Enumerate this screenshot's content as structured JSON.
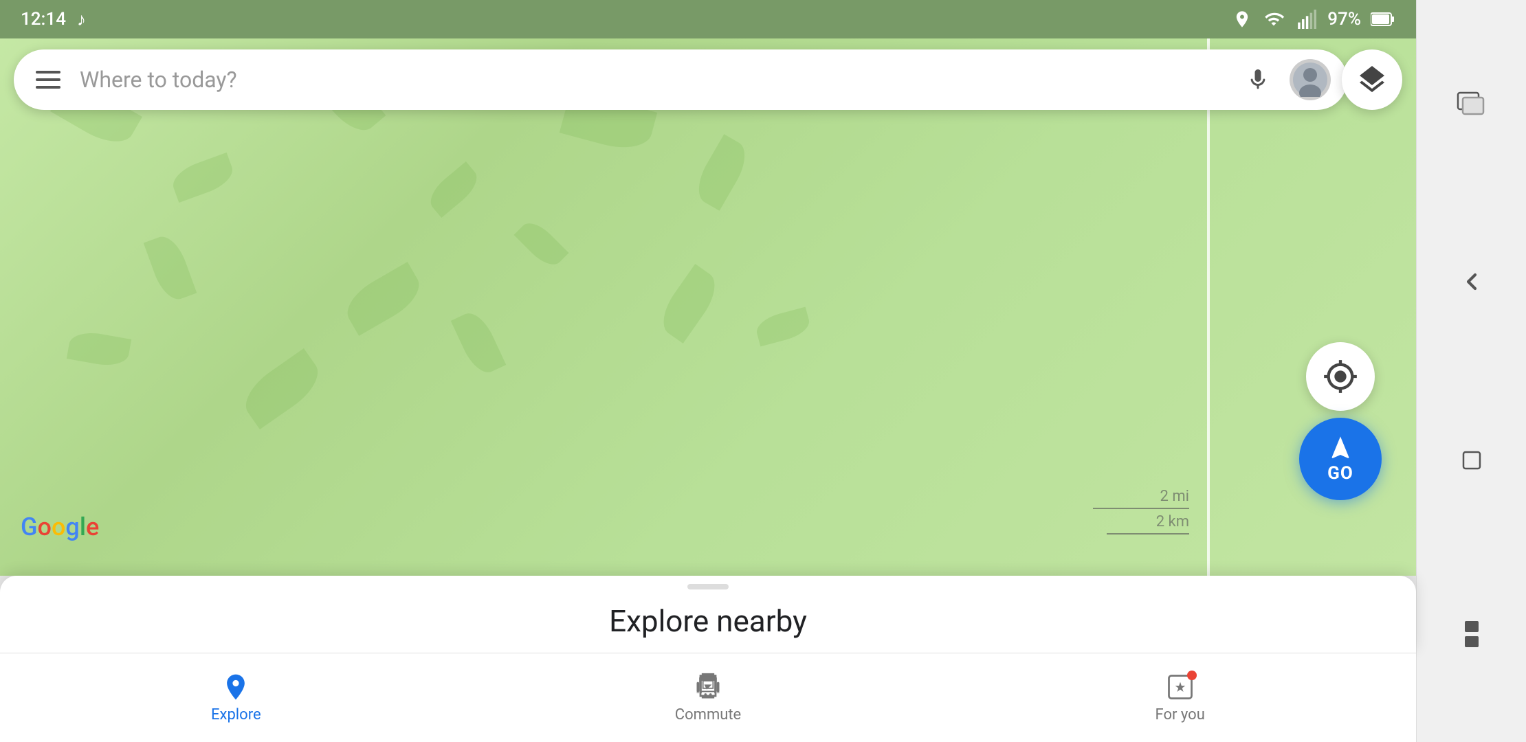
{
  "status_bar": {
    "time": "12:14",
    "music_icon": "♪",
    "battery_pct": "97%",
    "battery_icon": "battery"
  },
  "search": {
    "placeholder": "Where to today?"
  },
  "map": {
    "scale_2mi": "2 mi",
    "scale_2km": "2 km",
    "google_logo": "Google"
  },
  "go_button": {
    "label": "GO"
  },
  "bottom_sheet": {
    "handle": "",
    "explore_nearby": "Explore nearby"
  },
  "nav": {
    "items": [
      {
        "id": "explore",
        "label": "Explore",
        "active": true
      },
      {
        "id": "commute",
        "label": "Commute",
        "active": false
      },
      {
        "id": "for-you",
        "label": "For you",
        "active": false,
        "has_notif": true
      }
    ]
  },
  "layer_button": {
    "label": "layers"
  },
  "location_button": {
    "label": "my-location"
  }
}
